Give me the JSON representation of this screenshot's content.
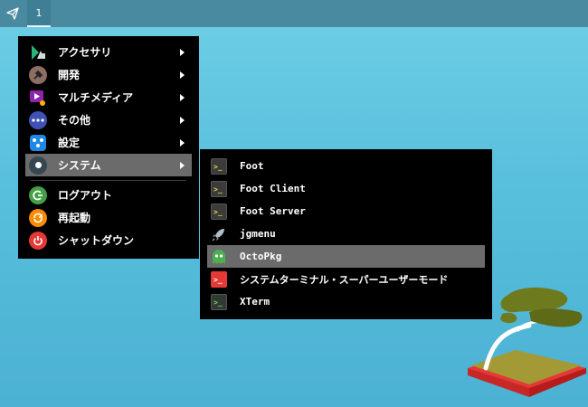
{
  "panel": {
    "workspace_label": "1"
  },
  "main_menu": {
    "items": [
      {
        "label": "アクセサリ",
        "icon": "accessories-icon",
        "has_submenu": true
      },
      {
        "label": "開発",
        "icon": "development-icon",
        "has_submenu": true
      },
      {
        "label": "マルチメディア",
        "icon": "multimedia-icon",
        "has_submenu": true
      },
      {
        "label": "その他",
        "icon": "other-icon",
        "has_submenu": true
      },
      {
        "label": "設定",
        "icon": "settings-icon",
        "has_submenu": true
      },
      {
        "label": "システム",
        "icon": "system-icon",
        "has_submenu": true,
        "active": true
      },
      {
        "label": "ログアウト",
        "icon": "logout-icon",
        "has_submenu": false
      },
      {
        "label": "再起動",
        "icon": "reboot-icon",
        "has_submenu": false
      },
      {
        "label": "シャットダウン",
        "icon": "shutdown-icon",
        "has_submenu": false
      }
    ]
  },
  "sub_menu": {
    "items": [
      {
        "label": "Foot",
        "icon": "terminal-icon"
      },
      {
        "label": "Foot Client",
        "icon": "terminal-icon"
      },
      {
        "label": "Foot Server",
        "icon": "terminal-icon"
      },
      {
        "label": "jgmenu",
        "icon": "rocket-icon"
      },
      {
        "label": "OctoPkg",
        "icon": "octopkg-ghost-icon",
        "active": true
      },
      {
        "label": "システムターミナル・スーパーユーザーモード",
        "icon": "root-terminal-icon"
      },
      {
        "label": "XTerm",
        "icon": "xterm-icon"
      }
    ]
  },
  "colors": {
    "panel": "#4a8aa0",
    "menu_bg": "#000000",
    "highlight": "#6b6b6b",
    "desktop": "#58bfdc"
  }
}
